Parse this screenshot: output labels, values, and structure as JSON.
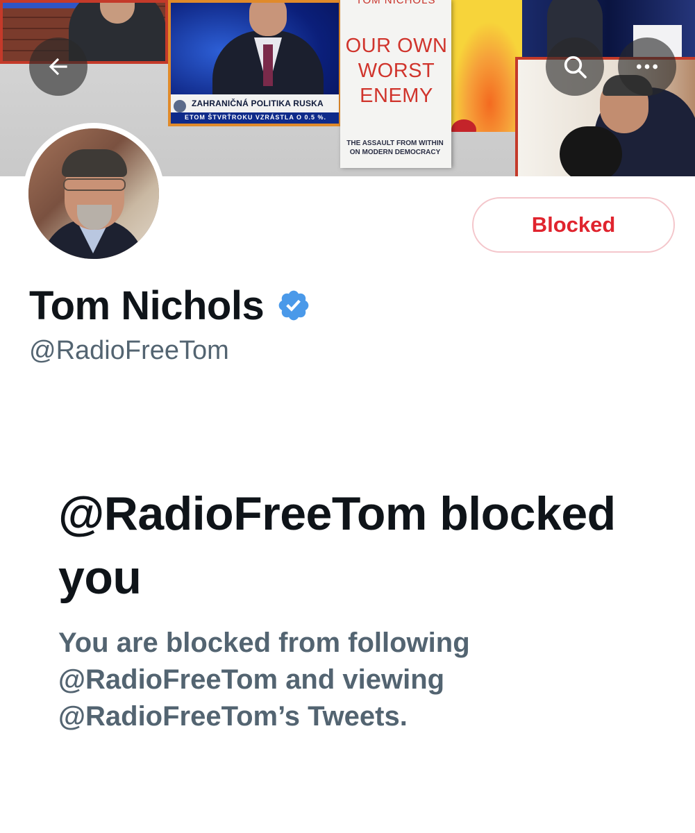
{
  "banner": {
    "news_ticker_headline": "ZAHRANIČNÁ POLITIKA RUSKA",
    "news_ticker_subline": "ETOM ŠTVRŤROKU VZRÁSTLA O 0.5 %.",
    "book": {
      "author": "TOM NICHOLS",
      "title_lines": [
        "OUR OWN",
        "WORST",
        "ENEMY"
      ],
      "subtitle": "THE ASSAULT FROM WITHIN ON MODERN DEMOCRACY"
    }
  },
  "nav": {
    "back_icon": "arrow-left-icon",
    "search_icon": "search-icon",
    "more_icon": "more-horizontal-icon"
  },
  "profile": {
    "display_name": "Tom Nichols",
    "handle": "@RadioFreeTom",
    "verified": true,
    "verified_color": "#4a99e9",
    "action_button_label": "Blocked",
    "action_button_color": "#e0242e"
  },
  "blocked_notice": {
    "title": "@RadioFreeTom blocked you",
    "body": "You are blocked from following @RadioFreeTom and viewing @RadioFreeTom’s Tweets."
  }
}
